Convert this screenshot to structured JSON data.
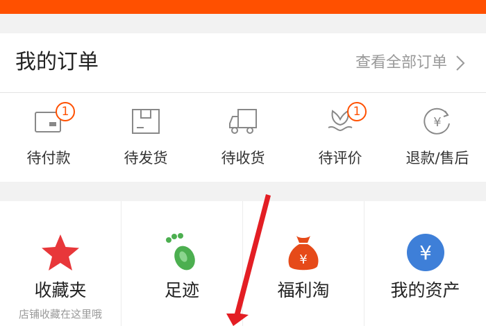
{
  "colors": {
    "accent": "#ff5000",
    "star": "#e8373a",
    "footprint": "#4caf50",
    "asset": "#3e7fd8",
    "arrow": "#e31e24"
  },
  "orders": {
    "title": "我的订单",
    "view_all": "查看全部订单",
    "items": [
      {
        "label": "待付款",
        "icon": "wallet-icon",
        "badge": "1"
      },
      {
        "label": "待发货",
        "icon": "package-icon",
        "badge": ""
      },
      {
        "label": "待收货",
        "icon": "truck-icon",
        "badge": ""
      },
      {
        "label": "待评价",
        "icon": "flower-icon",
        "badge": "1"
      },
      {
        "label": "退款/售后",
        "icon": "refund-yen-icon",
        "badge": ""
      }
    ]
  },
  "tools": [
    {
      "name": "收藏夹",
      "sub": "店铺收藏在这里哦",
      "icon": "star-icon"
    },
    {
      "name": "足迹",
      "sub": "",
      "icon": "footprint-icon"
    },
    {
      "name": "福利淘",
      "sub": "",
      "icon": "money-bag-icon"
    },
    {
      "name": "我的资产",
      "sub": "",
      "icon": "yen-coin-icon"
    }
  ],
  "icon_text": {
    "yen": "¥"
  }
}
